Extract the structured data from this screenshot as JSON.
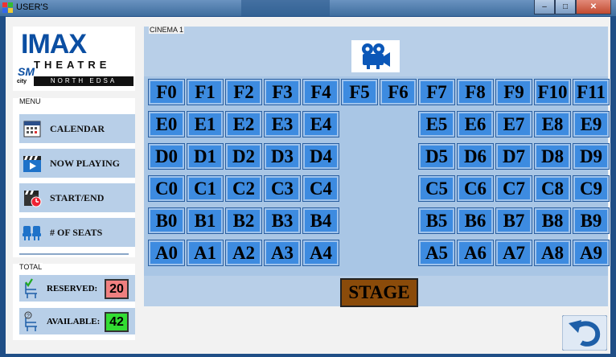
{
  "window": {
    "title": "USER'S"
  },
  "logo": {
    "brand": "IMAX",
    "subtitle": "THEATRE",
    "mall": "SM",
    "city": "city",
    "location": "NORTH EDSA"
  },
  "menu": {
    "label": "MENU",
    "items": [
      {
        "label": "CALENDAR",
        "icon": "calendar-icon"
      },
      {
        "label": "NOW PLAYING",
        "icon": "clapperboard-play-icon"
      },
      {
        "label": "START/END",
        "icon": "clapperboard-clock-icon"
      },
      {
        "label": "# OF SEATS",
        "icon": "seats-icon"
      }
    ]
  },
  "totals": {
    "label": "TOTAL",
    "reserved": {
      "label": "RESERVED:",
      "value": "20",
      "color": "#f08080"
    },
    "available": {
      "label": "AVAILABLE:",
      "value": "42",
      "color": "#33dd33"
    }
  },
  "cinema": {
    "label": "CINEMA 1",
    "stage": "STAGE",
    "rows": [
      {
        "row": "F",
        "left": [
          "F0",
          "F1",
          "F2",
          "F3",
          "F4",
          "F5",
          "F6"
        ],
        "right": [
          "F7",
          "F8",
          "F9",
          "F10",
          "F11"
        ]
      },
      {
        "row": "E",
        "left": [
          "E0",
          "E1",
          "E2",
          "E3",
          "E4"
        ],
        "right": [
          "E5",
          "E6",
          "E7",
          "E8",
          "E9"
        ]
      },
      {
        "row": "D",
        "left": [
          "D0",
          "D1",
          "D2",
          "D3",
          "D4"
        ],
        "right": [
          "D5",
          "D6",
          "D7",
          "D8",
          "D9"
        ]
      },
      {
        "row": "C",
        "left": [
          "C0",
          "C1",
          "C2",
          "C3",
          "C4"
        ],
        "right": [
          "C5",
          "C6",
          "C7",
          "C8",
          "C9"
        ]
      },
      {
        "row": "B",
        "left": [
          "B0",
          "B1",
          "B2",
          "B3",
          "B4"
        ],
        "right": [
          "B5",
          "B6",
          "B7",
          "B8",
          "B9"
        ]
      },
      {
        "row": "A",
        "left": [
          "A0",
          "A1",
          "A2",
          "A3",
          "A4"
        ],
        "right": [
          "A5",
          "A6",
          "A7",
          "A8",
          "A9"
        ]
      }
    ]
  },
  "colors": {
    "seat": "#3d8be0",
    "stage": "#8a4b0a",
    "panel": "#b8cfe8"
  }
}
